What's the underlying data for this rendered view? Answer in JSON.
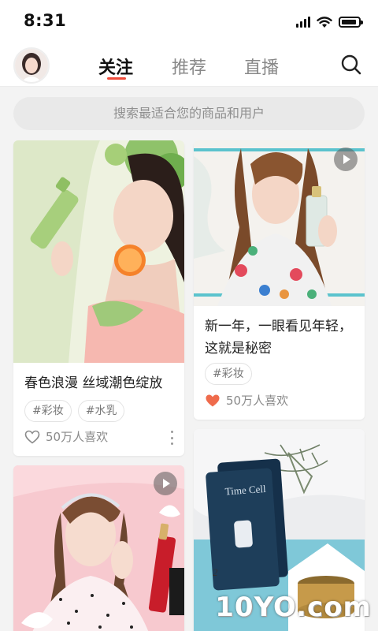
{
  "status_bar": {
    "time": "8:31"
  },
  "nav": {
    "tabs": [
      {
        "label": "关注",
        "active": true
      },
      {
        "label": "推荐",
        "active": false
      },
      {
        "label": "直播",
        "active": false
      }
    ],
    "accent_color": "#ef4b3a"
  },
  "search": {
    "placeholder": "搜索最适合您的商品和用户"
  },
  "feed": {
    "cards": [
      {
        "title": "春色浪漫 丝域潮色绽放",
        "tags": [
          "#彩妆",
          "#水乳"
        ],
        "likes": "50万人喜欢",
        "liked": false,
        "video": false
      },
      {
        "title": "新一年，一眼看见年轻，这就是秘密",
        "tags": [
          "#彩妆"
        ],
        "likes": "50万人喜欢",
        "liked": true,
        "video": true
      },
      {
        "title": "",
        "tags": [],
        "likes": "",
        "liked": false,
        "video": true,
        "product_text": "Time Cell"
      },
      {
        "title": "",
        "tags": [],
        "likes": "",
        "liked": false,
        "video": true
      }
    ]
  },
  "watermark": "10YO.com"
}
